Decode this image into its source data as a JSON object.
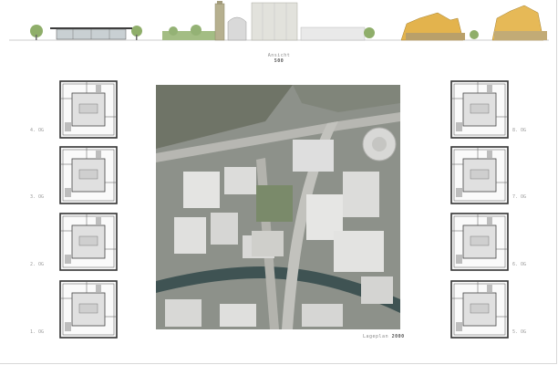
{
  "elevation": {
    "title": "Ansicht",
    "scale": "500"
  },
  "site_plan": {
    "title": "Lageplan",
    "scale": "2000"
  },
  "left_plans": [
    {
      "label": "4. OG"
    },
    {
      "label": "3. OG"
    },
    {
      "label": "2. OG"
    },
    {
      "label": "1. OG"
    }
  ],
  "right_plans": [
    {
      "label": "8. OG"
    },
    {
      "label": "7. OG"
    },
    {
      "label": "6. OG"
    },
    {
      "label": "5. OG"
    }
  ]
}
